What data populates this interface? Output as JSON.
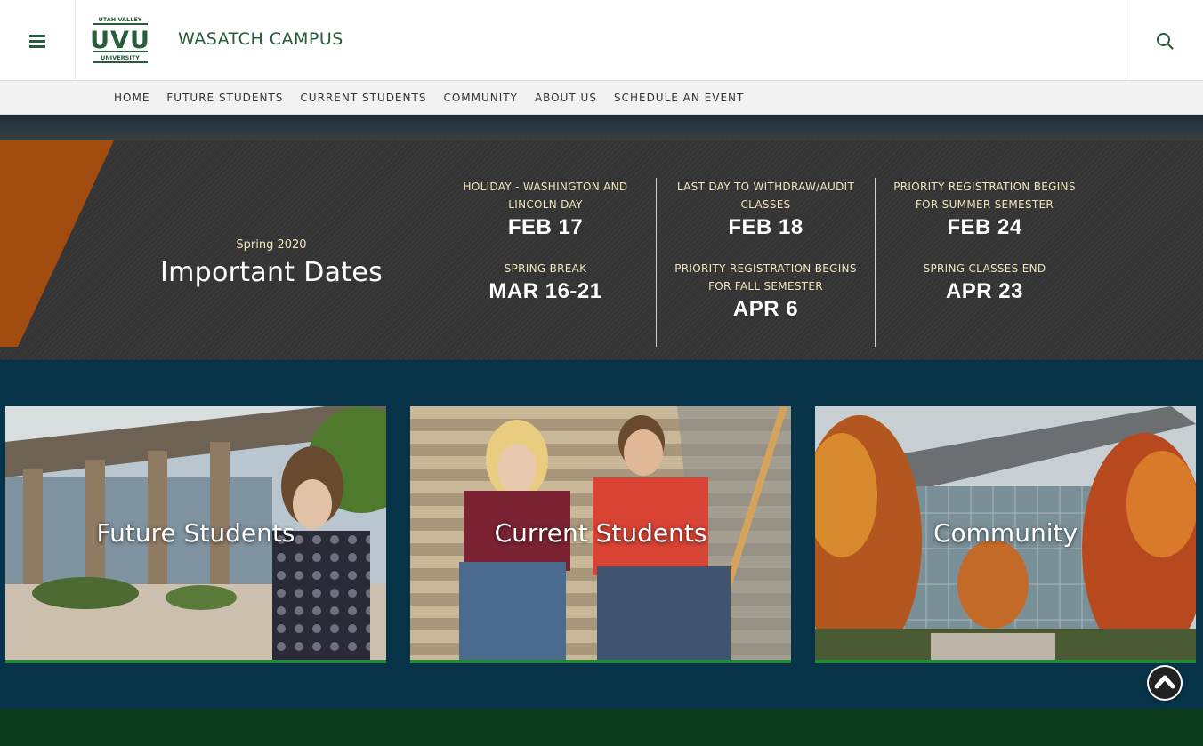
{
  "header": {
    "menu_icon": "hamburger-icon",
    "logo": {
      "top_text": "UTAH VALLEY",
      "mark": "UVU",
      "bottom_text": "UNIVERSITY"
    },
    "campus_title": "WASATCH CAMPUS",
    "search_icon": "search-icon"
  },
  "nav": {
    "items": [
      {
        "label": "HOME"
      },
      {
        "label": "FUTURE STUDENTS"
      },
      {
        "label": "CURRENT STUDENTS"
      },
      {
        "label": "COMMUNITY"
      },
      {
        "label": "ABOUT US"
      },
      {
        "label": "SCHEDULE AN EVENT"
      }
    ]
  },
  "important_dates": {
    "subtitle": "Spring 2020",
    "title": "Important Dates",
    "columns": [
      [
        {
          "label": "HOLIDAY - WASHINGTON AND LINCOLN DAY",
          "date": "FEB 17"
        },
        {
          "label": "SPRING BREAK",
          "date": "MAR 16-21"
        }
      ],
      [
        {
          "label": "LAST DAY TO WITHDRAW/AUDIT CLASSES",
          "date": "FEB 18"
        },
        {
          "label": "PRIORITY REGISTRATION BEGINS FOR FALL SEMESTER",
          "date": "APR 6"
        }
      ],
      [
        {
          "label": "PRIORITY REGISTRATION BEGINS FOR SUMMER SEMESTER",
          "date": "FEB 24"
        },
        {
          "label": "SPRING CLASSES END",
          "date": "APR 23"
        }
      ]
    ]
  },
  "cards": [
    {
      "label": "Future Students"
    },
    {
      "label": "Current Students"
    },
    {
      "label": "Community"
    }
  ],
  "scroll_top_icon": "chevron-up-icon",
  "colors": {
    "brand_green": "#275d38",
    "accent_orange": "#a34c0f",
    "dates_bg": "#343434",
    "cards_bg": "#073349",
    "card_border": "#1f8a3a",
    "footer_bg": "#0a3a1a"
  }
}
